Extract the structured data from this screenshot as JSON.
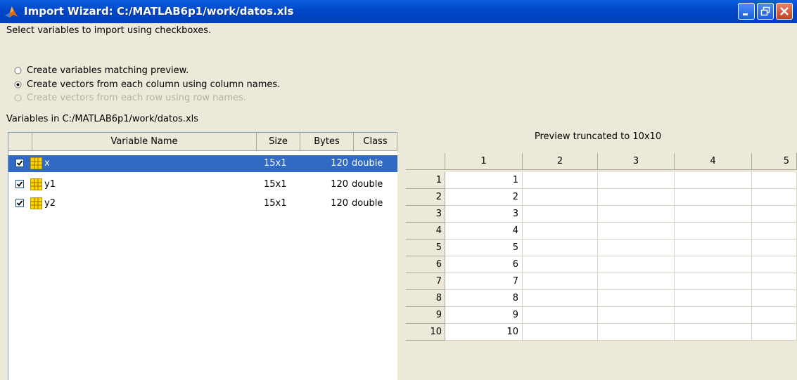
{
  "window": {
    "title": "Import Wizard: C:/MATLAB6p1/work/datos.xls",
    "icon": "matlab-logo-icon",
    "buttons": [
      "minimize",
      "restore",
      "close"
    ]
  },
  "instructions": "Select variables to import using checkboxes.",
  "options": [
    {
      "label": "Create variables matching preview.",
      "selected": false,
      "enabled": true
    },
    {
      "label": "Create vectors from each column using column names.",
      "selected": true,
      "enabled": true
    },
    {
      "label": "Create vectors from each row using row names.",
      "selected": false,
      "enabled": false
    }
  ],
  "variables": {
    "label": "Variables in C:/MATLAB6p1/work/datos.xls",
    "headers": {
      "name": "Variable Name",
      "size": "Size",
      "bytes": "Bytes",
      "class": "Class"
    },
    "rows": [
      {
        "checked": true,
        "name": "x",
        "size": "15x1",
        "bytes": "120",
        "class": "double",
        "selected": true
      },
      {
        "checked": true,
        "name": "y1",
        "size": "15x1",
        "bytes": "120",
        "class": "double",
        "selected": false
      },
      {
        "checked": true,
        "name": "y2",
        "size": "15x1",
        "bytes": "120",
        "class": "double",
        "selected": false
      }
    ]
  },
  "preview": {
    "caption": "Preview truncated to 10x10",
    "column_headers": [
      "1",
      "2",
      "3",
      "4",
      "5"
    ],
    "row_headers": [
      "1",
      "2",
      "3",
      "4",
      "5",
      "6",
      "7",
      "8",
      "9",
      "10"
    ],
    "cells": [
      [
        "1",
        "",
        "",
        "",
        ""
      ],
      [
        "2",
        "",
        "",
        "",
        ""
      ],
      [
        "3",
        "",
        "",
        "",
        ""
      ],
      [
        "4",
        "",
        "",
        "",
        ""
      ],
      [
        "5",
        "",
        "",
        "",
        ""
      ],
      [
        "6",
        "",
        "",
        "",
        ""
      ],
      [
        "7",
        "",
        "",
        "",
        ""
      ],
      [
        "8",
        "",
        "",
        "",
        ""
      ],
      [
        "9",
        "",
        "",
        "",
        ""
      ],
      [
        "10",
        "",
        "",
        "",
        ""
      ]
    ]
  },
  "colors": {
    "titlebar": "#0047c8",
    "selection": "#316ac5",
    "window_bg": "#ece9d8"
  }
}
